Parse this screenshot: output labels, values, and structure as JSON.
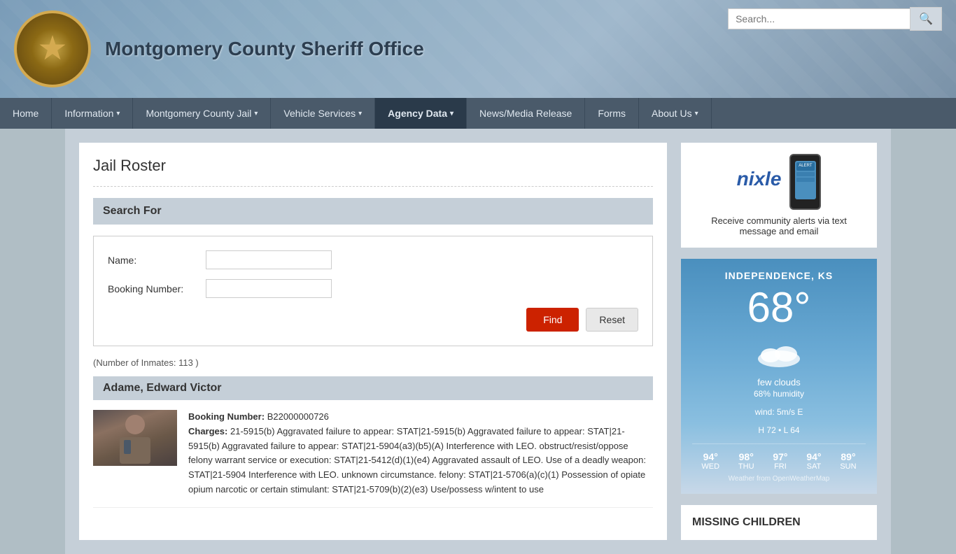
{
  "site": {
    "title": "Montgomery County Sheriff Office",
    "logo_alt": "Montgomery County Sheriff Badge"
  },
  "search_bar": {
    "placeholder": "Search...",
    "button_label": "🔍"
  },
  "nav": {
    "items": [
      {
        "label": "Home",
        "active": false,
        "has_arrow": false
      },
      {
        "label": "Information",
        "active": false,
        "has_arrow": true
      },
      {
        "label": "Montgomery County Jail",
        "active": false,
        "has_arrow": true
      },
      {
        "label": "Vehicle Services",
        "active": false,
        "has_arrow": true
      },
      {
        "label": "Agency Data",
        "active": true,
        "has_arrow": true
      },
      {
        "label": "News/Media Release",
        "active": false,
        "has_arrow": false
      },
      {
        "label": "Forms",
        "active": false,
        "has_arrow": false
      },
      {
        "label": "About Us",
        "active": false,
        "has_arrow": true
      }
    ]
  },
  "page": {
    "title": "Jail Roster",
    "search_section_title": "Search For",
    "name_label": "Name:",
    "booking_number_label": "Booking Number:",
    "name_placeholder": "",
    "booking_placeholder": "",
    "find_button": "Find",
    "reset_button": "Reset",
    "inmates_count": "(Number of Inmates: 113 )"
  },
  "inmate": {
    "name": "Adame, Edward Victor",
    "booking_number_label": "Booking Number:",
    "booking_number": "B22000000726",
    "charges_label": "Charges:",
    "charges": "21-5915(b) Aggravated failure to appear: STAT|21-5915(b) Aggravated failure to appear: STAT|21-5915(b) Aggravated failure to appear: STAT|21-5904(a3)(b5)(A) Interference with LEO. obstruct/resist/oppose felony warrant service or execution: STAT|21-5412(d)(1)(e4) Aggravated assault of LEO. Use of a deadly weapon: STAT|21-5904 Interference with LEO. unknown circumstance. felony: STAT|21-5706(a)(c)(1) Possession of opiate opium narcotic or certain stimulant: STAT|21-5709(b)(2)(e3) Use/possess w/intent to use"
  },
  "nixle": {
    "logo": "nixle",
    "tagline": "Receive community alerts via text message and email"
  },
  "weather": {
    "city": "INDEPENDENCE, KS",
    "temperature": "68°",
    "description": "few clouds",
    "humidity": "68% humidity",
    "wind": "wind: 5m/s E",
    "high": "H 72",
    "low": "L 64",
    "forecast": [
      {
        "day": "WED",
        "temp": "94°"
      },
      {
        "day": "THU",
        "temp": "98°"
      },
      {
        "day": "FRI",
        "temp": "97°"
      },
      {
        "day": "SAT",
        "temp": "94°"
      },
      {
        "day": "SUN",
        "temp": "89°"
      }
    ],
    "source": "Weather from OpenWeatherMap"
  },
  "missing_children": {
    "title": "MISSING CHILDREN"
  }
}
